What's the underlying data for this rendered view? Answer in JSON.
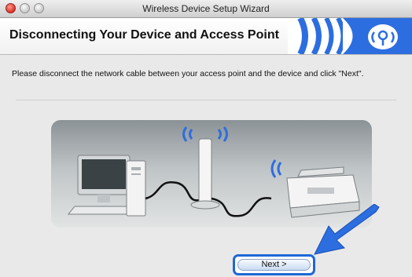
{
  "window": {
    "title": "Wireless Device Setup Wizard"
  },
  "header": {
    "title": "Disconnecting Your Device and Access Point"
  },
  "body": {
    "instruction": "Please disconnect the network cable between your access point and the device and click \"Next\"."
  },
  "buttons": {
    "next_label": "Next >"
  },
  "icons": [
    "close-icon",
    "minimize-icon",
    "zoom-icon",
    "wireless-logo-icon",
    "computer-icon",
    "access-point-icon",
    "printer-icon",
    "pointer-arrow-icon"
  ],
  "colors": {
    "accent": "#1f67d8",
    "logo_blue": "#2c6ee0"
  }
}
